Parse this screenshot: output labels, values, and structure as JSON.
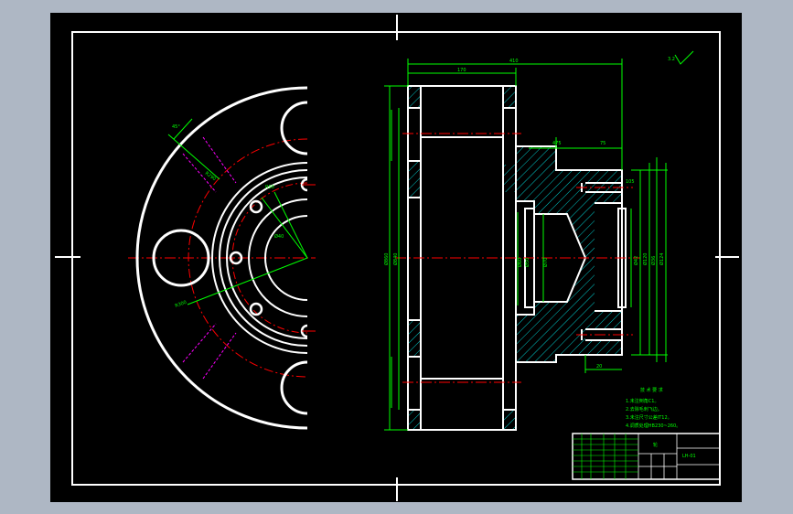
{
  "colors": {
    "window_bg": "#aeb7c4",
    "canvas_bg": "#000000",
    "geometry": "#ffffff",
    "dimension": "#00ff00",
    "centerline": "#ff0000",
    "construction": "#ff00ff",
    "hatch": "#00ffff",
    "annotation": "#00ff00"
  },
  "drawing": {
    "top_dimensions": [
      "410",
      "170"
    ],
    "hub_dimensions": [
      "475",
      "75"
    ],
    "hub_small_dim": "105",
    "hub_bottom_dim": "20",
    "left_diameters": [
      "Ø860",
      "Ø840"
    ],
    "hub_diameters": [
      "Ø60",
      "Ø50",
      "Ø42",
      "Ø36"
    ],
    "bore_label": "Ø70",
    "hub_right_diameters": [
      "Ø120",
      "Ø124"
    ],
    "angle_label": "45°",
    "radius_labels": [
      "R290",
      "R50",
      "R300"
    ],
    "hole_label": "Ø40",
    "roughness": "3.2"
  },
  "notes": {
    "title": "技 术 要 求",
    "items": [
      "1.未注倒角C1。",
      "2.去除毛刺飞边。",
      "3.未注尺寸公差IT12。",
      "4.调质处理HB230~260。"
    ]
  },
  "title_block": {
    "part_name": "轮",
    "drawing_no": "LH-01"
  }
}
